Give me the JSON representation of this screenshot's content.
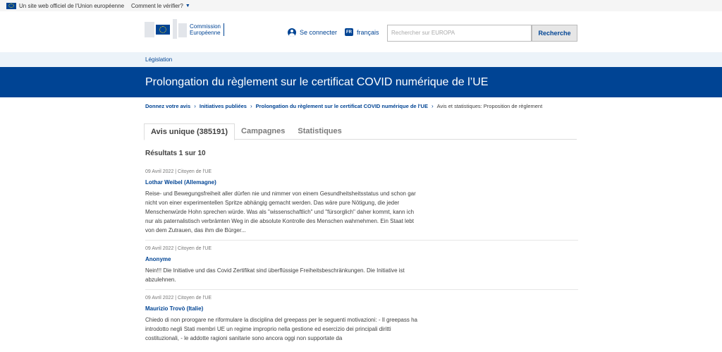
{
  "topbar": {
    "official": "Un site web officiel de l'Union européenne",
    "verify": "Comment le vérifier?"
  },
  "header": {
    "logo_line1": "Commission",
    "logo_line2": "Européenne",
    "login": "Se connecter",
    "lang_code": "FR",
    "lang": "français",
    "search_placeholder": "Rechercher sur EUROPA",
    "search_button": "Recherche"
  },
  "legislation": "Législation",
  "title": "Prolongation du règlement sur le certificat COVID numérique de l’UE",
  "breadcrumb": [
    "Donnez votre avis",
    "Initiatives publiées",
    "Prolongation du règlement sur le certificat COVID numérique de l'UE",
    "Avis et statistiques: Proposition de règlement"
  ],
  "tabs": [
    "Avis unique (385191)",
    "Campagnes",
    "Statistiques"
  ],
  "results": "Résultats 1 sur 10",
  "feedback": [
    {
      "meta": "09 Avril 2022 | Citoyen de l'UE",
      "author": "Lothar Weibel (Allemagne)",
      "text": "Reise- und Bewegungsfreiheit aller dürfen nie und nimmer von einem Gesundheitsheitsstatus und schon gar nicht von einer experimentellen Spritze abhängig gemacht werden. Das wäre pure Nötigung, die jeder Menschenwürde Hohn sprechen würde. Was als \"wissenschaftlich\" und \"fürsorglich\" daher kommt, kann ich nur als paternalistisch verbrämten Weg in die absolute Kontrolle des Menschen wahrnehmen. Ein Staat lebt von dem Zutrauen, das ihm die Bürger..."
    },
    {
      "meta": "09 Avril 2022 | Citoyen de l'UE",
      "author": "Anonyme",
      "text": "Nein!!! Die Initiative und das Covid Zertifikat sind überflüssige Freiheitsbeschränkungen. Die Initiative ist abzulehnen."
    },
    {
      "meta": "09 Avril 2022 | Citoyen de l'UE",
      "author": "Maurizio Trovò (Italie)",
      "text": "Chiedo di non prorogare ne riformulare la disciplina del greepass per le seguenti motivazioni: - Il greepass ha introdotto negli Stati membri UE un regime improprio nella gestione ed esercizio dei principali diritti costituzionali, - le addotte ragioni sanitarie sono ancora oggi non supportate da"
    }
  ]
}
